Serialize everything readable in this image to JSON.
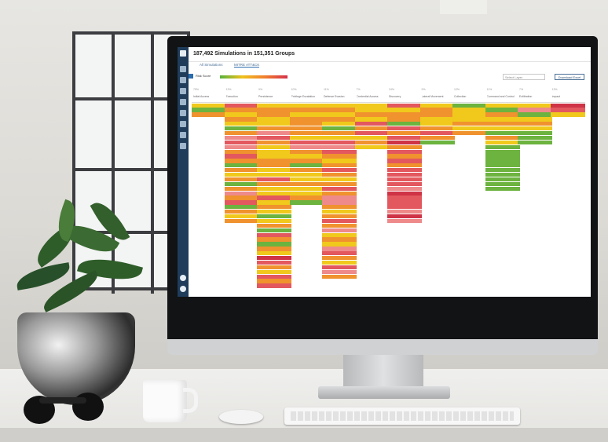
{
  "app": {
    "title": "187,492 Simulations in 151,351 Groups",
    "tabs": [
      "All Simulations",
      "MITRE ATT&CK"
    ],
    "toolbar": {
      "legend_label": "Risk Score",
      "filter_placeholder": "Select Layer",
      "export_button": "Download Excel"
    },
    "sidebar_icons": [
      "logo-icon",
      "menu-icon",
      "dashboard-icon",
      "grid-icon",
      "list-icon",
      "shield-icon",
      "target-icon",
      "settings-icon",
      "search-icon",
      "user-icon",
      "help-icon"
    ]
  },
  "matrix": {
    "columns": [
      {
        "name": "Initial Access",
        "pct": "75%"
      },
      {
        "name": "Execution",
        "pct": "13%"
      },
      {
        "name": "Persistence",
        "pct": "9%"
      },
      {
        "name": "Privilege Escalation",
        "pct": "10%"
      },
      {
        "name": "Defense Evasion",
        "pct": "11%"
      },
      {
        "name": "Credential Access",
        "pct": "7%"
      },
      {
        "name": "Discovery",
        "pct": "24%"
      },
      {
        "name": "Lateral Movement",
        "pct": "9%"
      },
      {
        "name": "Collection",
        "pct": "12%"
      },
      {
        "name": "Command and Control",
        "pct": "11%"
      },
      {
        "name": "Exfiltration",
        "pct": "7%"
      },
      {
        "name": "Impact",
        "pct": "13%"
      }
    ]
  },
  "colors": {
    "sidebar": "#1f3c5a",
    "accent": "#2b6cb0",
    "green": "#6cb33f",
    "yellow": "#f0c91c",
    "orange": "#f0922e",
    "red": "#e3585e"
  }
}
